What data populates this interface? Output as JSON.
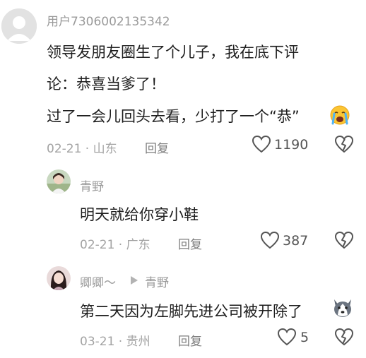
{
  "comments": [
    {
      "username": "用户7306002135342",
      "content_lines": [
        "领导发朋友圈生了个儿子，我在底下评",
        "论：恭喜当爹了！",
        "过了一会儿回头去看，少打了一个“恭”"
      ],
      "emoji": "crying-face",
      "date": "02-21 · 山东",
      "reply_label": "回复",
      "likes": "1190"
    },
    {
      "username": "青野",
      "content_lines": [
        "明天就给你穿小鞋"
      ],
      "date": "02-21 · 广东",
      "reply_label": "回复",
      "likes": "387"
    },
    {
      "username": "卿卿～",
      "reply_to": "青野",
      "content_lines": [
        "第二天因为左脚先进公司被开除了"
      ],
      "emoji": "husky-dog-face",
      "date": "03-21 · 贵州",
      "reply_label": "回复",
      "likes": "5"
    }
  ],
  "icons": {
    "like": "heart-outline-icon",
    "dislike": "broken-heart-icon",
    "reply_arrow": "play-triangle-icon"
  },
  "colors": {
    "meta_text": "#a3a3a3",
    "body_text": "#1e1e1e",
    "icon_stroke": "#555555"
  }
}
